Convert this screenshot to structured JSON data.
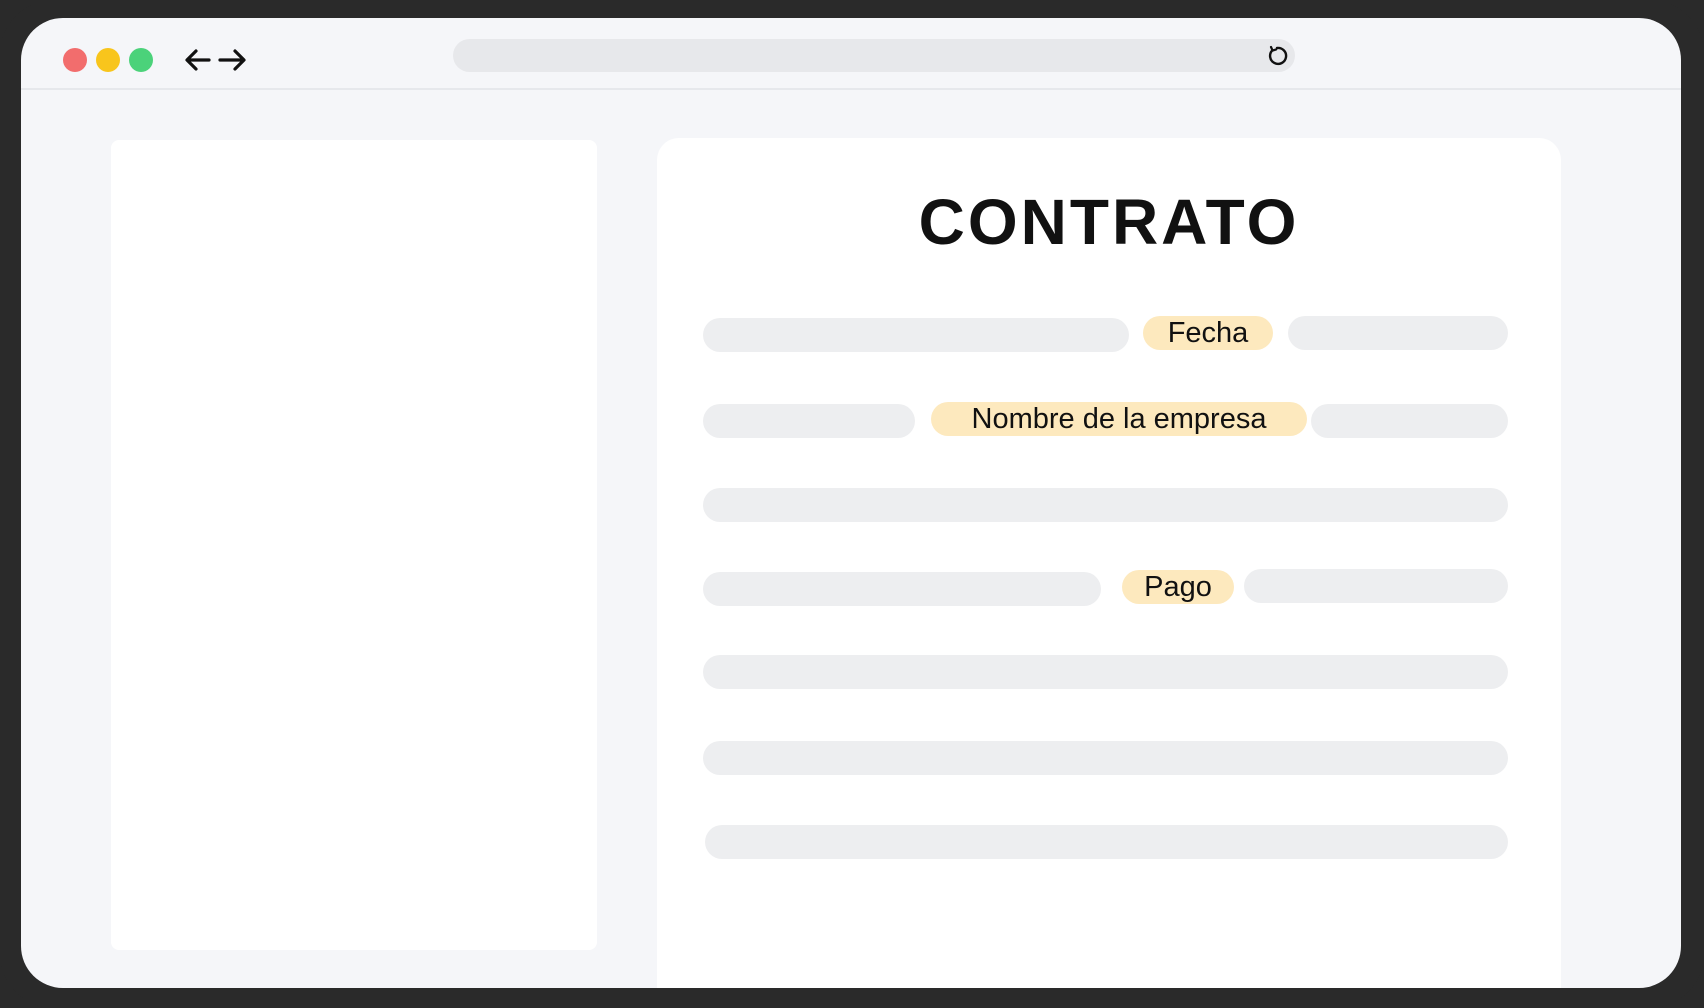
{
  "window_controls": {
    "close_color": "#f26d6d",
    "minimize_color": "#f8c51c",
    "maximize_color": "#4bd27a"
  },
  "nav": {
    "back_icon": "arrow-left-icon",
    "forward_icon": "arrow-right-icon"
  },
  "address_bar": {
    "value": "",
    "reload_icon": "reload-icon"
  },
  "document": {
    "title": "CONTRATO",
    "placeholders": {
      "date": "Fecha",
      "company": "Nombre de la empresa",
      "payment": "Pago"
    }
  },
  "colors": {
    "frame": "#2a2a2a",
    "background": "#f5f6f9",
    "text_line": "#edeef0",
    "highlight": "#fde9be"
  }
}
